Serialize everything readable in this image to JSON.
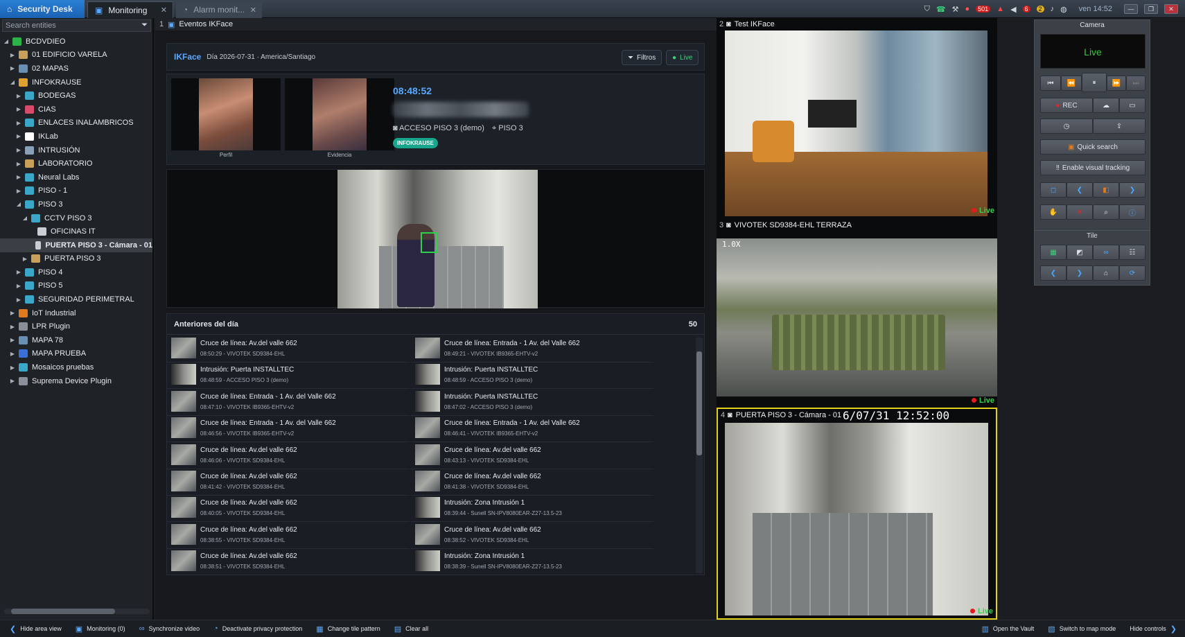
{
  "tabs": [
    {
      "label": "Security Desk"
    },
    {
      "label": "Monitoring"
    },
    {
      "label": "Alarm monit..."
    }
  ],
  "tray": {
    "badge_alerts": "501",
    "badge_6": "6",
    "badge_2": "2",
    "clock": "ven 14:52"
  },
  "sidebar": {
    "search_placeholder": "Search entities",
    "items": [
      {
        "label": "BCDVDIEO",
        "level": 0,
        "arrow": "open",
        "color": "#2db24a"
      },
      {
        "label": "01 EDIFICIO VARELA",
        "level": 1,
        "arrow": "closed",
        "color": "#c9a05a"
      },
      {
        "label": "02 MAPAS",
        "level": 1,
        "arrow": "closed",
        "color": "#6a8fb5"
      },
      {
        "label": "INFOKRAUSE",
        "level": 1,
        "arrow": "open",
        "color": "#e0a030"
      },
      {
        "label": "BODEGAS",
        "level": 2,
        "arrow": "closed",
        "color": "#3aa6c8"
      },
      {
        "label": "CIAS",
        "level": 2,
        "arrow": "closed",
        "color": "#d84a6a"
      },
      {
        "label": "ENLACES INALAMBRICOS",
        "level": 2,
        "arrow": "closed",
        "color": "#3aa6c8"
      },
      {
        "label": "IKLab",
        "level": 2,
        "arrow": "closed",
        "color": "#ffffff"
      },
      {
        "label": "INTRUSIÓN",
        "level": 2,
        "arrow": "closed",
        "color": "#8aa0b8"
      },
      {
        "label": "LABORATORIO",
        "level": 2,
        "arrow": "closed",
        "color": "#c9a05a"
      },
      {
        "label": "Neural Labs",
        "level": 2,
        "arrow": "closed",
        "color": "#3aa6c8"
      },
      {
        "label": "PISO - 1",
        "level": 2,
        "arrow": "closed",
        "color": "#3aa6c8"
      },
      {
        "label": "PISO 3",
        "level": 2,
        "arrow": "open",
        "color": "#3aa6c8"
      },
      {
        "label": "CCTV PISO 3",
        "level": 3,
        "arrow": "open",
        "color": "#3aa6c8"
      },
      {
        "label": "OFICINAS IT",
        "level": 4,
        "arrow": "none",
        "color": "#c9ced5"
      },
      {
        "label": "PUERTA PISO 3 - Cámara - 01",
        "level": 4,
        "arrow": "none",
        "color": "#c9ced5",
        "selected": true
      },
      {
        "label": "PUERTA PISO 3",
        "level": 3,
        "arrow": "closed",
        "color": "#c9a05a"
      },
      {
        "label": "PISO 4",
        "level": 2,
        "arrow": "closed",
        "color": "#3aa6c8"
      },
      {
        "label": "PISO 5",
        "level": 2,
        "arrow": "closed",
        "color": "#3aa6c8"
      },
      {
        "label": "SEGURIDAD PERIMETRAL",
        "level": 2,
        "arrow": "closed",
        "color": "#3aa6c8"
      },
      {
        "label": "IoT Industrial",
        "level": 1,
        "arrow": "closed",
        "color": "#e07a20"
      },
      {
        "label": "LPR Plugin",
        "level": 1,
        "arrow": "closed",
        "color": "#8a9099"
      },
      {
        "label": "MAPA 78",
        "level": 1,
        "arrow": "closed",
        "color": "#6a8fb5"
      },
      {
        "label": "MAPA PRUEBA",
        "level": 1,
        "arrow": "closed",
        "color": "#3a6fd8"
      },
      {
        "label": "Mosaicos pruebas",
        "level": 1,
        "arrow": "closed",
        "color": "#3aa6c8"
      },
      {
        "label": "Suprema Device Plugin",
        "level": 1,
        "arrow": "closed",
        "color": "#8a9099"
      }
    ]
  },
  "panel": {
    "number": "1",
    "title": "Eventos IKFace",
    "brand": "IKFace",
    "date": "Día 2026-07-31 · America/Santiago",
    "filter_label": "Filtros",
    "live_label": "Live",
    "photo_profile": "Perfil",
    "photo_evidence": "Evidencia",
    "event_time": "08:48:52",
    "event_camera": "ACCESO PISO 3 (demo)",
    "event_floor": "PISO 3",
    "event_tag": "INFOKRAUSE",
    "list_title": "Anteriores del día",
    "list_count": "50"
  },
  "events": [
    {
      "title": "Cruce de línea: Av.del valle 662",
      "sub": "08:50:29 - VIVOTEK SD9384-EHL",
      "kind": "street"
    },
    {
      "title": "Cruce de línea: Entrada - 1 Av. del Valle 662",
      "sub": "08:49:21 - VIVOTEK IB9365-EHTV-v2",
      "kind": "street"
    },
    {
      "title": "Intrusión: Puerta INSTALLTEC",
      "sub": "08:48:59 - ACCESO PISO 3 (demo)",
      "kind": "intr"
    },
    {
      "title": "Intrusión: Puerta INSTALLTEC",
      "sub": "08:48:59 - ACCESO PISO 3 (demo)",
      "kind": "intr"
    },
    {
      "title": "Cruce de línea: Entrada - 1 Av. del Valle 662",
      "sub": "08:47:10 - VIVOTEK IB9365-EHTV-v2",
      "kind": "street"
    },
    {
      "title": "Intrusión: Puerta INSTALLTEC",
      "sub": "08:47:02 - ACCESO PISO 3 (demo)",
      "kind": "intr"
    },
    {
      "title": "Cruce de línea: Entrada - 1 Av. del Valle 662",
      "sub": "08:46:56 - VIVOTEK IB9365-EHTV-v2",
      "kind": "street"
    },
    {
      "title": "Cruce de línea: Entrada - 1 Av. del Valle 662",
      "sub": "08:46:41 - VIVOTEK IB9365-EHTV-v2",
      "kind": "street"
    },
    {
      "title": "Cruce de línea: Av.del valle 662",
      "sub": "08:46:06 - VIVOTEK SD9384-EHL",
      "kind": "street"
    },
    {
      "title": "Cruce de línea: Av.del valle 662",
      "sub": "08:43:13 - VIVOTEK SD9384-EHL",
      "kind": "street"
    },
    {
      "title": "Cruce de línea: Av.del valle 662",
      "sub": "08:41:42 - VIVOTEK SD9384-EHL",
      "kind": "street"
    },
    {
      "title": "Cruce de línea: Av.del valle 662",
      "sub": "08:41:38 - VIVOTEK SD9384-EHL",
      "kind": "street"
    },
    {
      "title": "Cruce de línea: Av.del valle 662",
      "sub": "08:40:05 - VIVOTEK SD9384-EHL",
      "kind": "street"
    },
    {
      "title": "Intrusión: Zona Intrusión 1",
      "sub": "08:39:44 - Sunell SN-IPV8080EAR-Z27-13.5-23",
      "kind": "zone"
    },
    {
      "title": "Cruce de línea: Av.del valle 662",
      "sub": "08:38:55 - VIVOTEK SD9384-EHL",
      "kind": "street"
    },
    {
      "title": "Cruce de línea: Av.del valle 662",
      "sub": "08:38:52 - VIVOTEK SD9384-EHL",
      "kind": "street"
    },
    {
      "title": "Cruce de línea: Av.del valle 662",
      "sub": "08:38:51 - VIVOTEK SD9384-EHL",
      "kind": "street"
    },
    {
      "title": "Intrusión: Zona Intrusión 1",
      "sub": "08:38:39 - Sunell SN-IPV8080EAR-Z27-13.5-23",
      "kind": "zone"
    }
  ],
  "cameras": [
    {
      "number": "2",
      "title": "Test IKFace",
      "live": "Live"
    },
    {
      "number": "3",
      "title": "VIVOTEK SD9384-EHL TERRAZA",
      "zoom": "1.0X",
      "live": "Live"
    },
    {
      "number": "4",
      "title": "PUERTA PISO 3 - Cámara - 01",
      "osd": "6/07/31 12:52:00",
      "live": "Live"
    }
  ],
  "control": {
    "title": "Camera",
    "screen": "Live",
    "rec": "REC",
    "quick_search": "Quick search",
    "visual_tracking": "Enable visual tracking",
    "tile_title": "Tile"
  },
  "bottom": [
    {
      "label": "Hide area view",
      "icon": "chevron-left-icon"
    },
    {
      "label": "Monitoring (0)",
      "icon": "monitor-icon"
    },
    {
      "label": "Synchronize video",
      "icon": "link-icon"
    },
    {
      "label": "Deactivate privacy protection",
      "icon": "privacy-icon"
    },
    {
      "label": "Change tile pattern",
      "icon": "grid-icon"
    },
    {
      "label": "Clear all",
      "icon": "clear-icon"
    }
  ],
  "bottom_right": [
    {
      "label": "Open the Vault",
      "icon": "vault-icon"
    },
    {
      "label": "Switch to map mode",
      "icon": "map-icon"
    },
    {
      "label": "Hide controls",
      "icon": "chevron-right-icon"
    }
  ]
}
